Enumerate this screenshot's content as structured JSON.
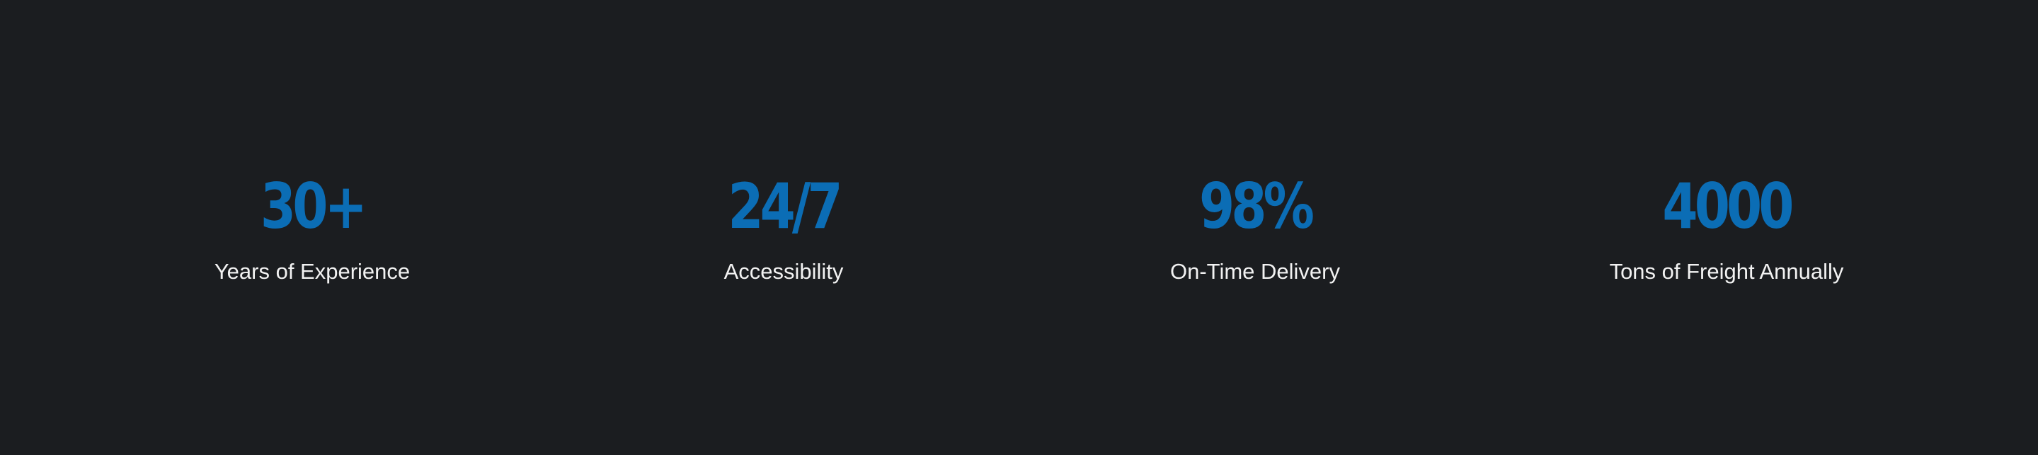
{
  "stats": [
    {
      "value": "30+",
      "label": "Years of Experience"
    },
    {
      "value": "24/7",
      "label": "Accessibility"
    },
    {
      "value": "98%",
      "label": "On-Time Delivery"
    },
    {
      "value": "4000",
      "label": "Tons of Freight Annually"
    }
  ],
  "colors": {
    "background": "#1b1d20",
    "accent": "#0b6db5",
    "label_text": "#f2f2f2"
  }
}
